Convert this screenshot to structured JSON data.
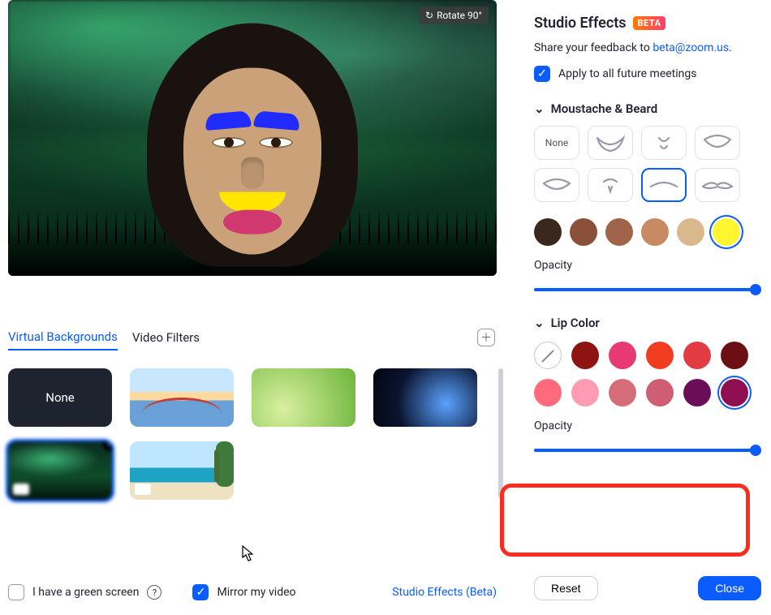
{
  "rotate_label": "Rotate 90°",
  "tabs": {
    "virtual_backgrounds": "Virtual Backgrounds",
    "video_filters": "Video Filters"
  },
  "thumbs": {
    "none": "None"
  },
  "bottom": {
    "green_screen": "I have a green screen",
    "mirror": "Mirror my video",
    "studio_link": "Studio Effects (Beta)"
  },
  "panel": {
    "title": "Studio Effects",
    "beta": "BETA",
    "feedback_prefix": "Share your feedback to  ",
    "feedback_email": "beta@zoom.us",
    "apply_all": "Apply to all future meetings",
    "moustache_heading": "Moustache & Beard",
    "lip_heading": "Lip Color",
    "opacity": "Opacity",
    "none_label": "None",
    "reset": "Reset",
    "close": "Close",
    "beard_colors": [
      "#3a281f",
      "#8a503a",
      "#a0644b",
      "#c78a63",
      "#d9b98c",
      "#fff531"
    ],
    "beard_selected_color": 5,
    "lip_colors_row1": [
      "none",
      "#8e1414",
      "#e83a72",
      "#f03d1f",
      "#e23b42",
      "#6b0f14"
    ],
    "lip_colors_row2": [
      "#ff6b7d",
      "#ff9bb2",
      "#d56d78",
      "#cf5e75",
      "#6a0e57",
      "#8e0e52"
    ],
    "lip_selected_index": 11,
    "moustache_opacity": 100,
    "lip_opacity": 100
  }
}
